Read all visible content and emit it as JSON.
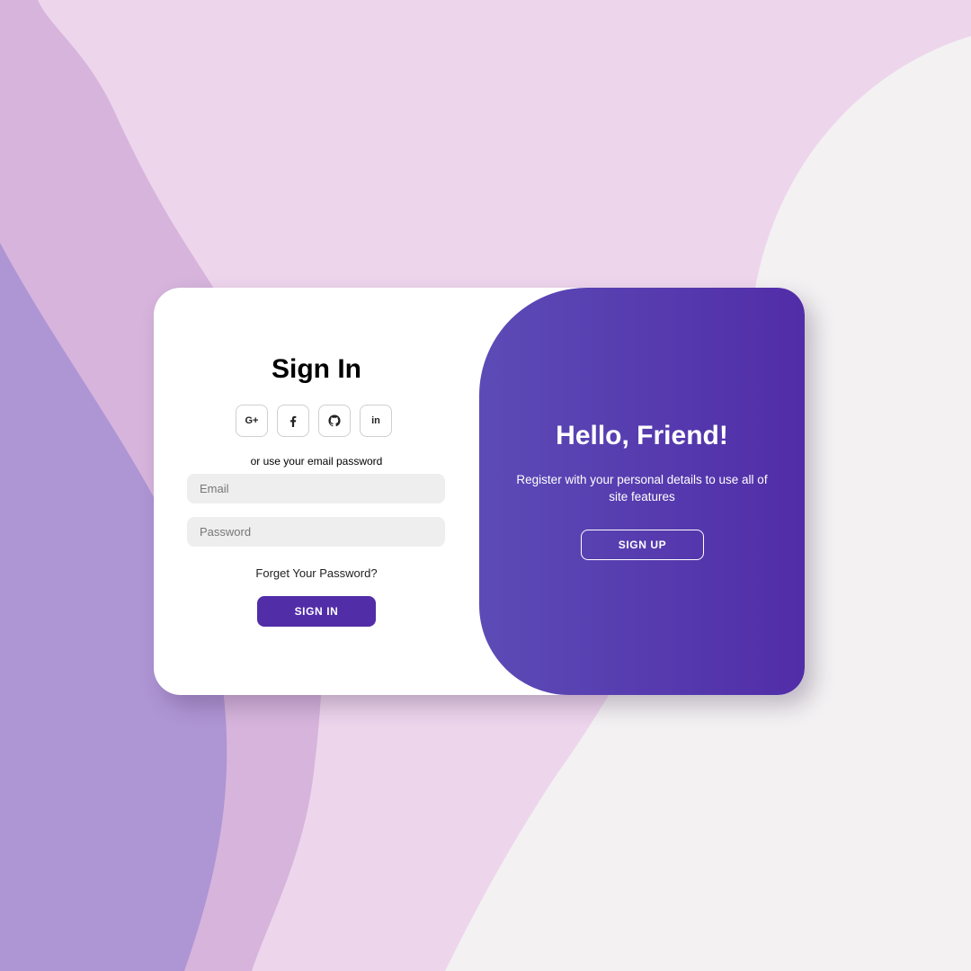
{
  "colors": {
    "accent": "#512da8",
    "gradient_start": "#5c4bb6",
    "gradient_end": "#512da8",
    "input_bg": "#eeeeee",
    "page_bg_light": "#f3f1f2",
    "page_bg_pink": "#edd5ec",
    "page_bg_mauve": "#d6b4dc",
    "page_bg_purple": "#ae95d4"
  },
  "signin": {
    "title": "Sign In",
    "social": [
      {
        "icon": "google-plus-icon",
        "glyph": "G+"
      },
      {
        "icon": "facebook-icon",
        "glyph": "f"
      },
      {
        "icon": "github-icon",
        "glyph": "github"
      },
      {
        "icon": "linkedin-icon",
        "glyph": "in"
      }
    ],
    "alt_text": "or use your email password",
    "email_placeholder": "Email",
    "password_placeholder": "Password",
    "forgot_label": "Forget Your Password?",
    "button_label": "SIGN IN"
  },
  "toggle": {
    "title": "Hello, Friend!",
    "text": "Register with your personal details to use all of site features",
    "button_label": "SIGN UP"
  }
}
